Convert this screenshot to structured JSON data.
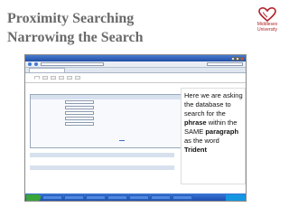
{
  "slide": {
    "title_line1": "Proximity Searching",
    "title_line2": "Narrowing the Search"
  },
  "logo": {
    "name_line1": "Middlesex",
    "name_line2": "University"
  },
  "callout": {
    "part1": "Here we are asking the database to search for the ",
    "bold1": "phrase",
    "part2": " within the SAME ",
    "bold2": "paragraph",
    "part3": " as the word ",
    "bold3": "Trident"
  },
  "colors": {
    "title": "#6a6a6a",
    "logo": "#b0232a",
    "browser_chrome": "#1f4fa6",
    "nexis_accent": "#2b4f8c",
    "taskbar": "#1d4fae"
  },
  "icons": {
    "logo": "heart-logo-icon"
  },
  "screenshot": {
    "window_title": "",
    "url": "",
    "browser_tab": "",
    "nexis_logo": "",
    "nexis_tabs": [
      "",
      "",
      "",
      "",
      "",
      ""
    ],
    "crumb": "",
    "crumb2": "",
    "panel_title": "",
    "advanced_link": "",
    "form": [
      {
        "label": "",
        "value": ""
      },
      {
        "label": "",
        "value": ""
      },
      {
        "label": "",
        "value": ""
      },
      {
        "label": "",
        "value": ""
      },
      {
        "label": "",
        "value": ""
      }
    ],
    "search_button": "",
    "section1": "",
    "link1": "",
    "section2": "",
    "link2": "",
    "footer_line1": "",
    "footer_line1_link": "",
    "footer_line2": "",
    "footer_line2_link": "",
    "footer_line3": "",
    "footer_logo": "",
    "start_button": "",
    "taskbar_items": [
      "",
      "",
      "",
      "",
      "",
      "",
      ""
    ],
    "tray_clock": ""
  }
}
